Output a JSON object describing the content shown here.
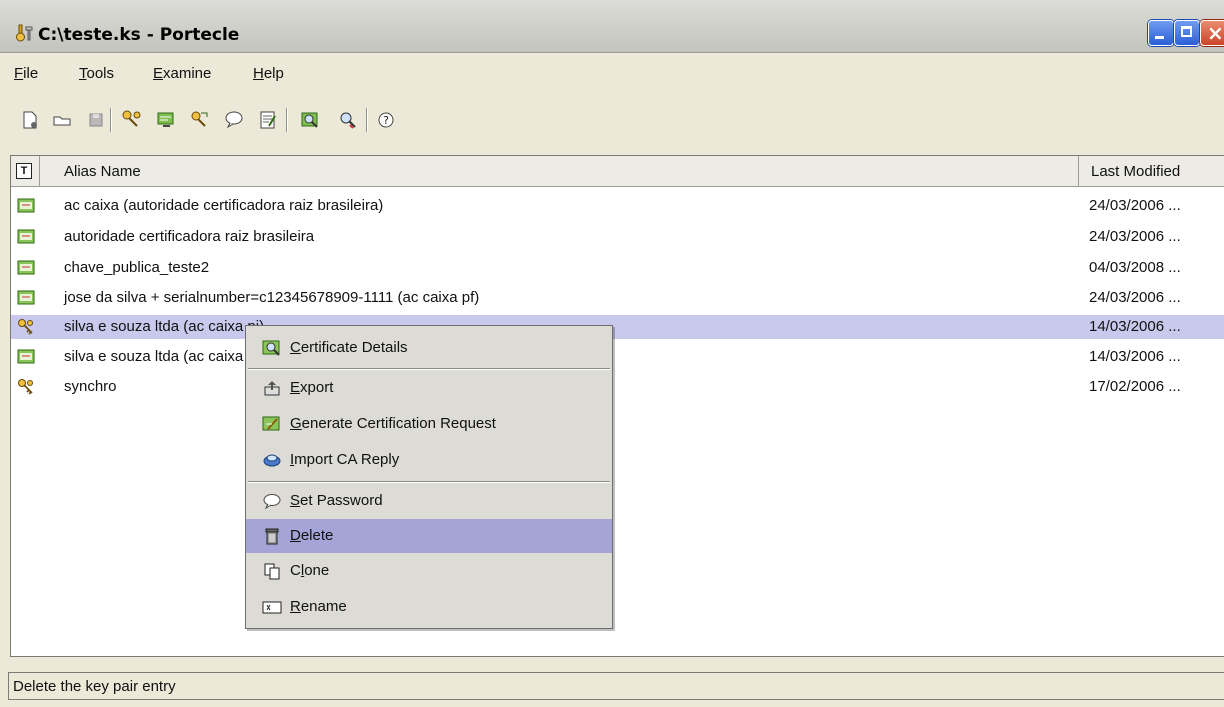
{
  "window": {
    "title": "C:\\teste.ks - Portecle"
  },
  "menu": {
    "file": "File",
    "tools": "Tools",
    "examine": "Examine",
    "help": "Help"
  },
  "table": {
    "columns": {
      "type": "T",
      "alias": "Alias Name",
      "modified": "Last Modified"
    },
    "rows": [
      {
        "alias": "ac caixa (autoridade certificadora raiz brasileira)",
        "modified": "24/03/2006 ...",
        "kind": "certificate"
      },
      {
        "alias": "autoridade certificadora raiz brasileira",
        "modified": "24/03/2006 ...",
        "kind": "certificate"
      },
      {
        "alias": "chave_publica_teste2",
        "modified": "04/03/2008 ...",
        "kind": "certificate"
      },
      {
        "alias": "jose da silva + serialnumber=c12345678909-1111 (ac caixa pf)",
        "modified": "24/03/2006 ...",
        "kind": "certificate"
      },
      {
        "alias": "silva e souza ltda (ac caixa pj)",
        "modified": "14/03/2006 ...",
        "kind": "key-pair"
      },
      {
        "alias": "silva e souza ltda (ac caixa pj)",
        "modified": "14/03/2006 ...",
        "kind": "certificate"
      },
      {
        "alias": "synchro",
        "modified": "17/02/2006 ...",
        "kind": "key-pair"
      }
    ]
  },
  "context_menu": {
    "items": [
      {
        "label": "Certificate Details",
        "icon": "certificate-details-icon"
      },
      {
        "label": "Export",
        "icon": "export-icon"
      },
      {
        "label": "Generate Certification Request",
        "icon": "generate-csr-icon"
      },
      {
        "label": "Import CA Reply",
        "icon": "import-ca-reply-icon"
      },
      {
        "label": "Set Password",
        "icon": "set-password-icon"
      },
      {
        "label": "Delete",
        "icon": "delete-icon"
      },
      {
        "label": "Clone",
        "icon": "clone-icon"
      },
      {
        "label": "Rename",
        "icon": "rename-icon"
      }
    ]
  },
  "status": {
    "text": "Delete the key pair entry"
  },
  "colors": {
    "selection": "#c9c9ee",
    "menu_highlight": "#a5a4d6"
  }
}
